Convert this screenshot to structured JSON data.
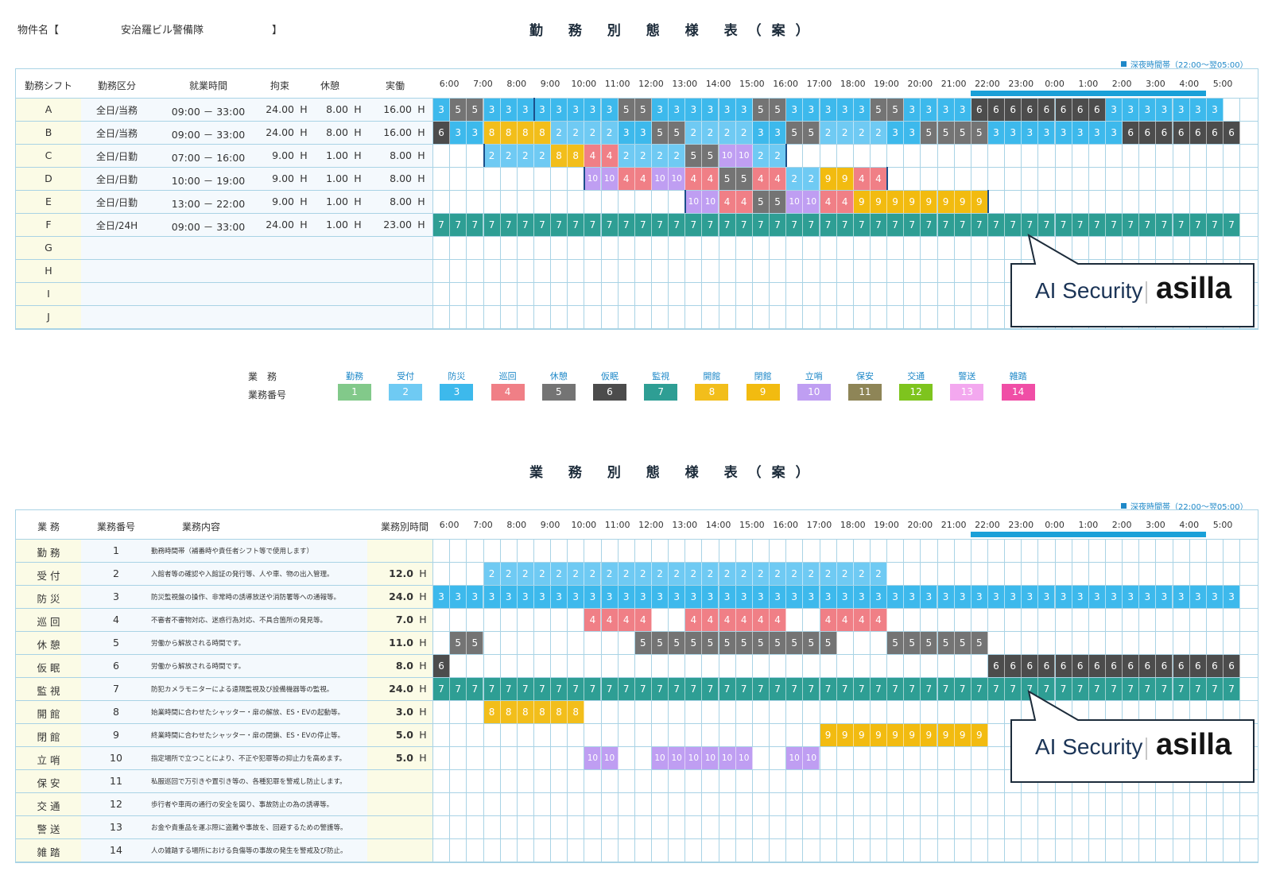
{
  "header": {
    "property_label": "物件名【",
    "property_name": "安治羅ビル警備隊",
    "property_close": "】",
    "title": "勤 務 別 態 様 表（案）"
  },
  "night_band_label": "深夜時間帯（22:00〜翌05:00）",
  "hours": [
    "6:00",
    "7:00",
    "8:00",
    "9:00",
    "10:00",
    "11:00",
    "12:00",
    "13:00",
    "14:00",
    "15:00",
    "16:00",
    "17:00",
    "18:00",
    "19:00",
    "20:00",
    "21:00",
    "22:00",
    "23:00",
    "0:00",
    "1:00",
    "2:00",
    "3:00",
    "4:00",
    "5:00"
  ],
  "colors": {
    "1": "#82c98a",
    "2": "#6fcaf3",
    "3": "#3db9ec",
    "4": "#f07f86",
    "5": "#747474",
    "6": "#4c4c4c",
    "7": "#2e9e94",
    "8": "#f2be1b",
    "9": "#f2bb10",
    "10": "#bf9ef2",
    "11": "#8e8557",
    "12": "#7ec41e",
    "13": "#f3a8ef",
    "14": "#f04ea6"
  },
  "shift_table": {
    "headers": {
      "shift": "勤務シフト",
      "category": "勤務区分",
      "time": "就業時間",
      "restraint": "拘束",
      "rest": "休憩",
      "actual": "実働"
    },
    "rows": [
      {
        "shift": "A",
        "category": "全日/当務",
        "time": "09:00 － 33:00",
        "restraint": "24.00",
        "rest": "8.00",
        "actual": "16.00",
        "start": 0,
        "slots": "3,5,5,3,3,3,3,3,3,3,3,5,5,3,3,3,3,3,3,5,5,3,3,3,3,3,5,5,3,3,3,3,6,6,6,6,6,6,6,6,3,3,3,3,3,3,3"
      },
      {
        "shift": "B",
        "category": "全日/当務",
        "time": "09:00 － 33:00",
        "restraint": "24.00",
        "rest": "8.00",
        "actual": "16.00",
        "start": 0,
        "slots": "6,3,3,8,8,8,8,2,2,2,2,3,3,5,5,2,2,2,2,3,3,5,5,2,2,2,2,3,3,5,5,5,5,3,3,3,3,3,3,3,3,6,6,6,6,6,6,6"
      },
      {
        "shift": "C",
        "category": "全日/日勤",
        "time": "07:00 － 16:00",
        "restraint": "9.00",
        "rest": "1.00",
        "actual": "8.00",
        "start": 3,
        "slots": "2,2,2,2,8,8,4,4,2,2,2,2,5,5,10,10,2,2"
      },
      {
        "shift": "D",
        "category": "全日/日勤",
        "time": "10:00 － 19:00",
        "restraint": "9.00",
        "rest": "1.00",
        "actual": "8.00",
        "start": 9,
        "slots": "10,10,4,4,10,10,4,4,5,5,4,4,2,2,9,9,4,4"
      },
      {
        "shift": "E",
        "category": "全日/日勤",
        "time": "13:00 － 22:00",
        "restraint": "9.00",
        "rest": "1.00",
        "actual": "8.00",
        "start": 15,
        "slots": "10,10,4,4,5,5,10,10,4,4,9,9,9,9,9,9,9,9"
      },
      {
        "shift": "F",
        "category": "全日/24H",
        "time": "09:00 － 33:00",
        "restraint": "24.00",
        "rest": "1.00",
        "actual": "23.00",
        "start": 0,
        "slots": "7,7,7,7,7,7,7,7,7,7,7,7,7,7,7,7,7,7,7,7,7,7,7,7,7,7,7,7,7,7,7,7,7,7,7,7,7,7,7,7,7,7,7,7,7,7,7,7"
      },
      {
        "shift": "G",
        "category": "",
        "time": "",
        "restraint": "",
        "rest": "",
        "actual": "",
        "start": 0,
        "slots": ""
      },
      {
        "shift": "H",
        "category": "",
        "time": "",
        "restraint": "",
        "rest": "",
        "actual": "",
        "start": 0,
        "slots": ""
      },
      {
        "shift": "I",
        "category": "",
        "time": "",
        "restraint": "",
        "rest": "",
        "actual": "",
        "start": 0,
        "slots": ""
      },
      {
        "shift": "J",
        "category": "",
        "time": "",
        "restraint": "",
        "rest": "",
        "actual": "",
        "start": 0,
        "slots": ""
      }
    ],
    "unit": "H"
  },
  "legend": {
    "row1_label": "業　務",
    "row2_label": "業務番号",
    "items": [
      {
        "name": "勤務",
        "num": "1"
      },
      {
        "name": "受付",
        "num": "2"
      },
      {
        "name": "防災",
        "num": "3"
      },
      {
        "name": "巡回",
        "num": "4"
      },
      {
        "name": "休憩",
        "num": "5"
      },
      {
        "name": "仮眠",
        "num": "6"
      },
      {
        "name": "監視",
        "num": "7"
      },
      {
        "name": "開館",
        "num": "8"
      },
      {
        "name": "閉館",
        "num": "9"
      },
      {
        "name": "立哨",
        "num": "10"
      },
      {
        "name": "保安",
        "num": "11"
      },
      {
        "name": "交通",
        "num": "12"
      },
      {
        "name": "警送",
        "num": "13"
      },
      {
        "name": "雑踏",
        "num": "14"
      }
    ]
  },
  "task_title": "業 務 別 態 様 表（案）",
  "task_table": {
    "headers": {
      "task": "業 務",
      "num": "業務番号",
      "content": "業務内容",
      "hours": "業務別時間"
    },
    "rows": [
      {
        "task": "勤 務",
        "num": "1",
        "content": "勤務時間帯（補番時や責任者シフト等で使用します）",
        "hours": "",
        "start": 0,
        "slots": ""
      },
      {
        "task": "受 付",
        "num": "2",
        "content": "入館者等の確認や入館証の発行等、人や車、物の出入管理。",
        "hours": "12.0",
        "start": 3,
        "slots": "2,2,2,2,2,2,2,2,2,2,2,2,2,2,2,2,2,2,2,2,2,2,2,2"
      },
      {
        "task": "防 災",
        "num": "3",
        "content": "防災監視盤の操作、非常時の誘導放送や消防署等への通報等。",
        "hours": "24.0",
        "start": 0,
        "slots": "3,3,3,3,3,3,3,3,3,3,3,3,3,3,3,3,3,3,3,3,3,3,3,3,3,3,3,3,3,3,3,3,3,3,3,3,3,3,3,3,3,3,3,3,3,3,3,3"
      },
      {
        "task": "巡 回",
        "num": "4",
        "content": "不審者不審物対応、迷惑行為対応、不具合箇所の発見等。",
        "hours": "7.0",
        "start": 9,
        "slots": "4,4,4,4,,,4,4,4,4,4,4,,,4,4,4,4"
      },
      {
        "task": "休 憩",
        "num": "5",
        "content": "労働から解放される時間です。",
        "hours": "11.0",
        "start": 1,
        "slots": "5,5,,,,,,,,,,5,5,5,5,5,5,5,5,5,5,5,5,,,,5,5,5,5,5,5"
      },
      {
        "task": "仮 眠",
        "num": "6",
        "content": "労働から解放される時間です。",
        "hours": "8.0",
        "start": 0,
        "slots": "6,,,,,,,,,,,,,,,,,,,,,,,,,,,,,,,,,6,6,6,6,6,6,6,6,6,6,6,6,6,6,6"
      },
      {
        "task": "監 視",
        "num": "7",
        "content": "防犯カメラモニターによる遠隔監視及び設備機器等の監視。",
        "hours": "24.0",
        "start": 0,
        "slots": "7,7,7,7,7,7,7,7,7,7,7,7,7,7,7,7,7,7,7,7,7,7,7,7,7,7,7,7,7,7,7,7,7,7,7,7,7,7,7,7,7,7,7,7,7,7,7,7"
      },
      {
        "task": "開 館",
        "num": "8",
        "content": "始業時間に合わせたシャッター・扉の解放、ES・EVの起動等。",
        "hours": "3.0",
        "start": 3,
        "slots": "8,8,8,8,8,8"
      },
      {
        "task": "閉 館",
        "num": "9",
        "content": "終業時間に合わせたシャッター・扉の閉鎖、ES・EVの停止等。",
        "hours": "5.0",
        "start": 23,
        "slots": "9,9,9,9,9,9,9,9,9,9"
      },
      {
        "task": "立 哨",
        "num": "10",
        "content": "指定場所で立つことにより、不正や犯罪等の抑止力を高めます。",
        "hours": "5.0",
        "start": 9,
        "slots": "10,10,,,10,10,10,10,10,10,,,10,10"
      },
      {
        "task": "保 安",
        "num": "11",
        "content": "私服巡回で万引きや置引き等の、各種犯罪を警戒し防止します。",
        "hours": "",
        "start": 0,
        "slots": ""
      },
      {
        "task": "交 通",
        "num": "12",
        "content": "歩行者や車両の通行の安全を図り、事故防止の為の誘導等。",
        "hours": "",
        "start": 0,
        "slots": ""
      },
      {
        "task": "警 送",
        "num": "13",
        "content": "お金や貴重品を運ぶ際に盗難や事故を、回避するための警護等。",
        "hours": "",
        "start": 0,
        "slots": ""
      },
      {
        "task": "雑 踏",
        "num": "14",
        "content": "人の雑踏する場所における負傷等の事故の発生を警戒及び防止。",
        "hours": "",
        "start": 0,
        "slots": ""
      }
    ],
    "unit": "H"
  },
  "logo": {
    "left": "AI Security",
    "right": "asilla"
  }
}
